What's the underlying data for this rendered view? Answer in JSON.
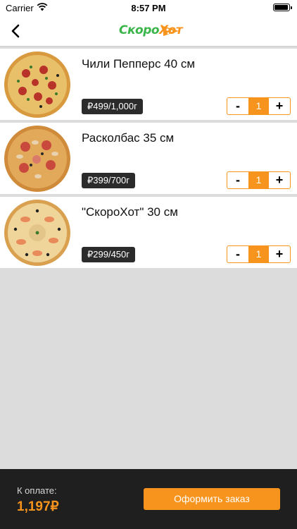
{
  "status_bar": {
    "carrier": "Carrier",
    "time": "8:57 PM"
  },
  "header": {
    "logo_part1": "Скоро",
    "logo_part2": "Хот",
    "back_icon": "chevron-left-icon"
  },
  "products": [
    {
      "name": "Чили Пепперс 40 см",
      "price": "₽499/1,000г",
      "qty": "1",
      "minus": "-",
      "plus": "+"
    },
    {
      "name": "Расколбас 35 см",
      "price": "₽399/700г",
      "qty": "1",
      "minus": "-",
      "plus": "+"
    },
    {
      "name": "\"СкороХот\" 30 см",
      "price": "₽299/450г",
      "qty": "1",
      "minus": "-",
      "plus": "+"
    }
  ],
  "footer": {
    "pay_label": "К оплате:",
    "total": "1,197₽",
    "order_button": "Оформить заказ"
  },
  "colors": {
    "accent": "#f7941d",
    "brand_green": "#3ab54a",
    "footer_bg": "#1f1f1f",
    "badge_bg": "#2b2b2b"
  }
}
